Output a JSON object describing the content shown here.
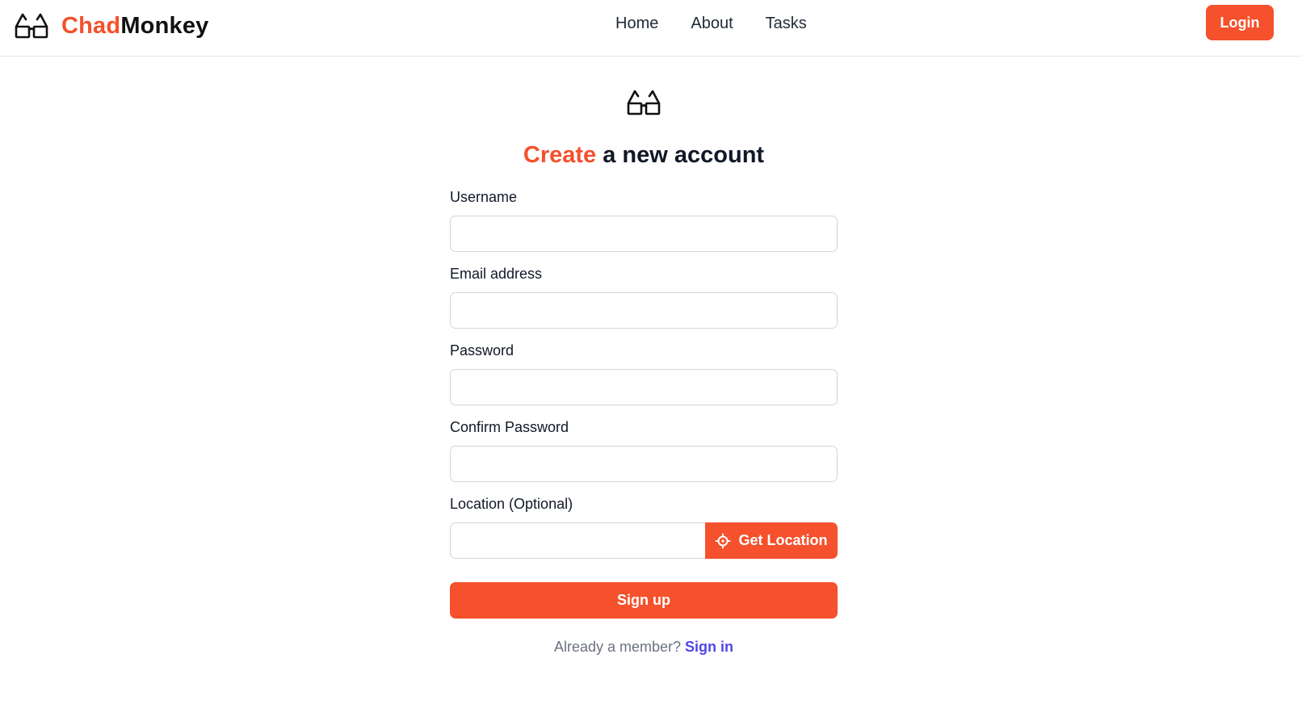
{
  "brand": {
    "accent": "Chad",
    "rest": "Monkey",
    "icon": "glasses-icon",
    "accent_color": "#f4512c"
  },
  "nav": {
    "items": [
      {
        "label": "Home"
      },
      {
        "label": "About"
      },
      {
        "label": "Tasks"
      }
    ],
    "login_label": "Login"
  },
  "form": {
    "logo_icon": "glasses-icon",
    "title_accent": "Create",
    "title_rest": " a new account",
    "fields": {
      "username": {
        "label": "Username",
        "value": "",
        "placeholder": ""
      },
      "email": {
        "label": "Email address",
        "value": "",
        "placeholder": ""
      },
      "password": {
        "label": "Password",
        "value": "",
        "placeholder": ""
      },
      "confirm_password": {
        "label": "Confirm Password",
        "value": "",
        "placeholder": ""
      },
      "location": {
        "label": "Location (Optional)",
        "value": "",
        "placeholder": ""
      }
    },
    "get_location_label": "Get Location",
    "get_location_icon": "crosshair-icon",
    "submit_label": "Sign up",
    "member_prompt": "Already a member? ",
    "member_link": "Sign in"
  },
  "colors": {
    "primary": "#f4512c",
    "link": "#4f46e5",
    "muted_text": "#6b7280"
  }
}
